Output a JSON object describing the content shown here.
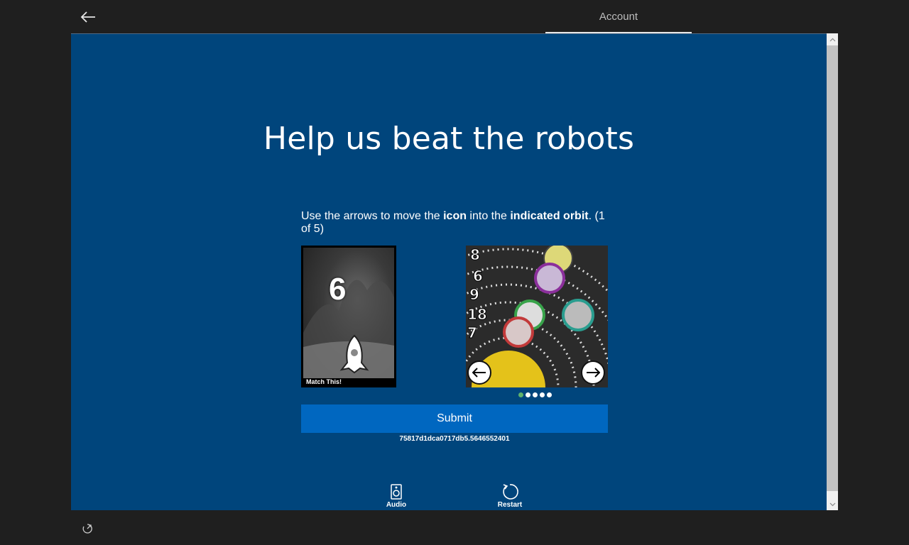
{
  "header": {
    "back_icon": "arrow-left-icon",
    "tab_account": "Account"
  },
  "main": {
    "title": "Help us beat the robots",
    "instructions": {
      "part1": "Use the arrows to move the ",
      "bold1": "icon",
      "part2": " into the ",
      "bold2": "indicated orbit",
      "part3": ". (1 of 5)"
    },
    "match_card": {
      "number": "6",
      "label": "Match This!",
      "icon": "rocket-icon"
    },
    "orbit_card": {
      "orbit_numbers": [
        "8",
        "6",
        "9",
        "18",
        "7"
      ],
      "prev_icon": "arrow-left-icon",
      "next_icon": "arrow-right-icon"
    },
    "pager": {
      "total": 5,
      "current": 1,
      "active_color": "#5fb26b"
    },
    "submit_label": "Submit",
    "session_id": "75817d1dca0717db5.5646552401"
  },
  "tools": {
    "audio_label": "Audio",
    "audio_icon": "speaker-icon",
    "restart_label": "Restart",
    "restart_icon": "restart-icon"
  },
  "footer": {
    "ease_icon": "accessibility-icon"
  },
  "colors": {
    "panel_bg": "#00457c",
    "frame_bg": "#1f1f1f",
    "submit_bg": "#0067c0"
  }
}
